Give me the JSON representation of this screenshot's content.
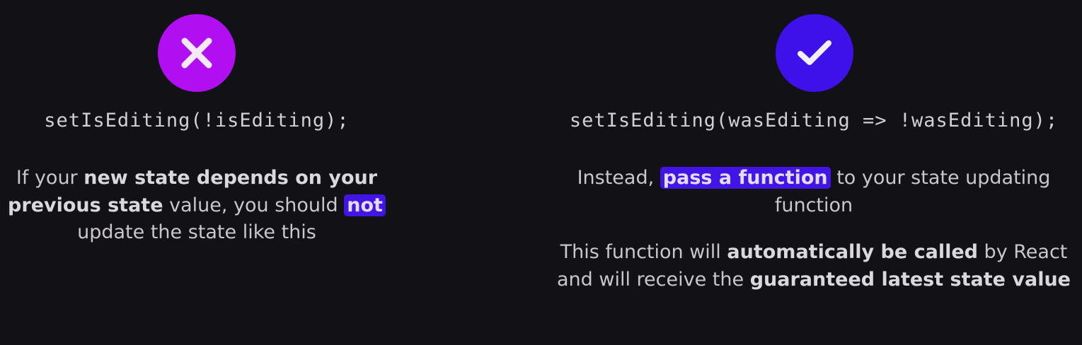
{
  "left": {
    "icon": "x-mark-icon",
    "color": "#b10ff2",
    "code": "setIsEditing(!isEditing);",
    "text": {
      "t1": "If your ",
      "b1": "new state depends on your previous state",
      "t2": " value, you should ",
      "hl": "not",
      "t3": " update the state like this"
    }
  },
  "right": {
    "icon": "check-mark-icon",
    "color": "#3e10ea",
    "code": "setIsEditing(wasEditing => !wasEditing);",
    "p1": {
      "t1": "Instead, ",
      "hl": "pass a function",
      "t2": " to your state updating function"
    },
    "p2": {
      "t1": "This function will ",
      "b1": "automatically be called",
      "t2": " by React and will receive the ",
      "b2": "guaranteed latest state value"
    }
  },
  "colors": {
    "background": "#121116",
    "highlight": "#4214e6"
  }
}
